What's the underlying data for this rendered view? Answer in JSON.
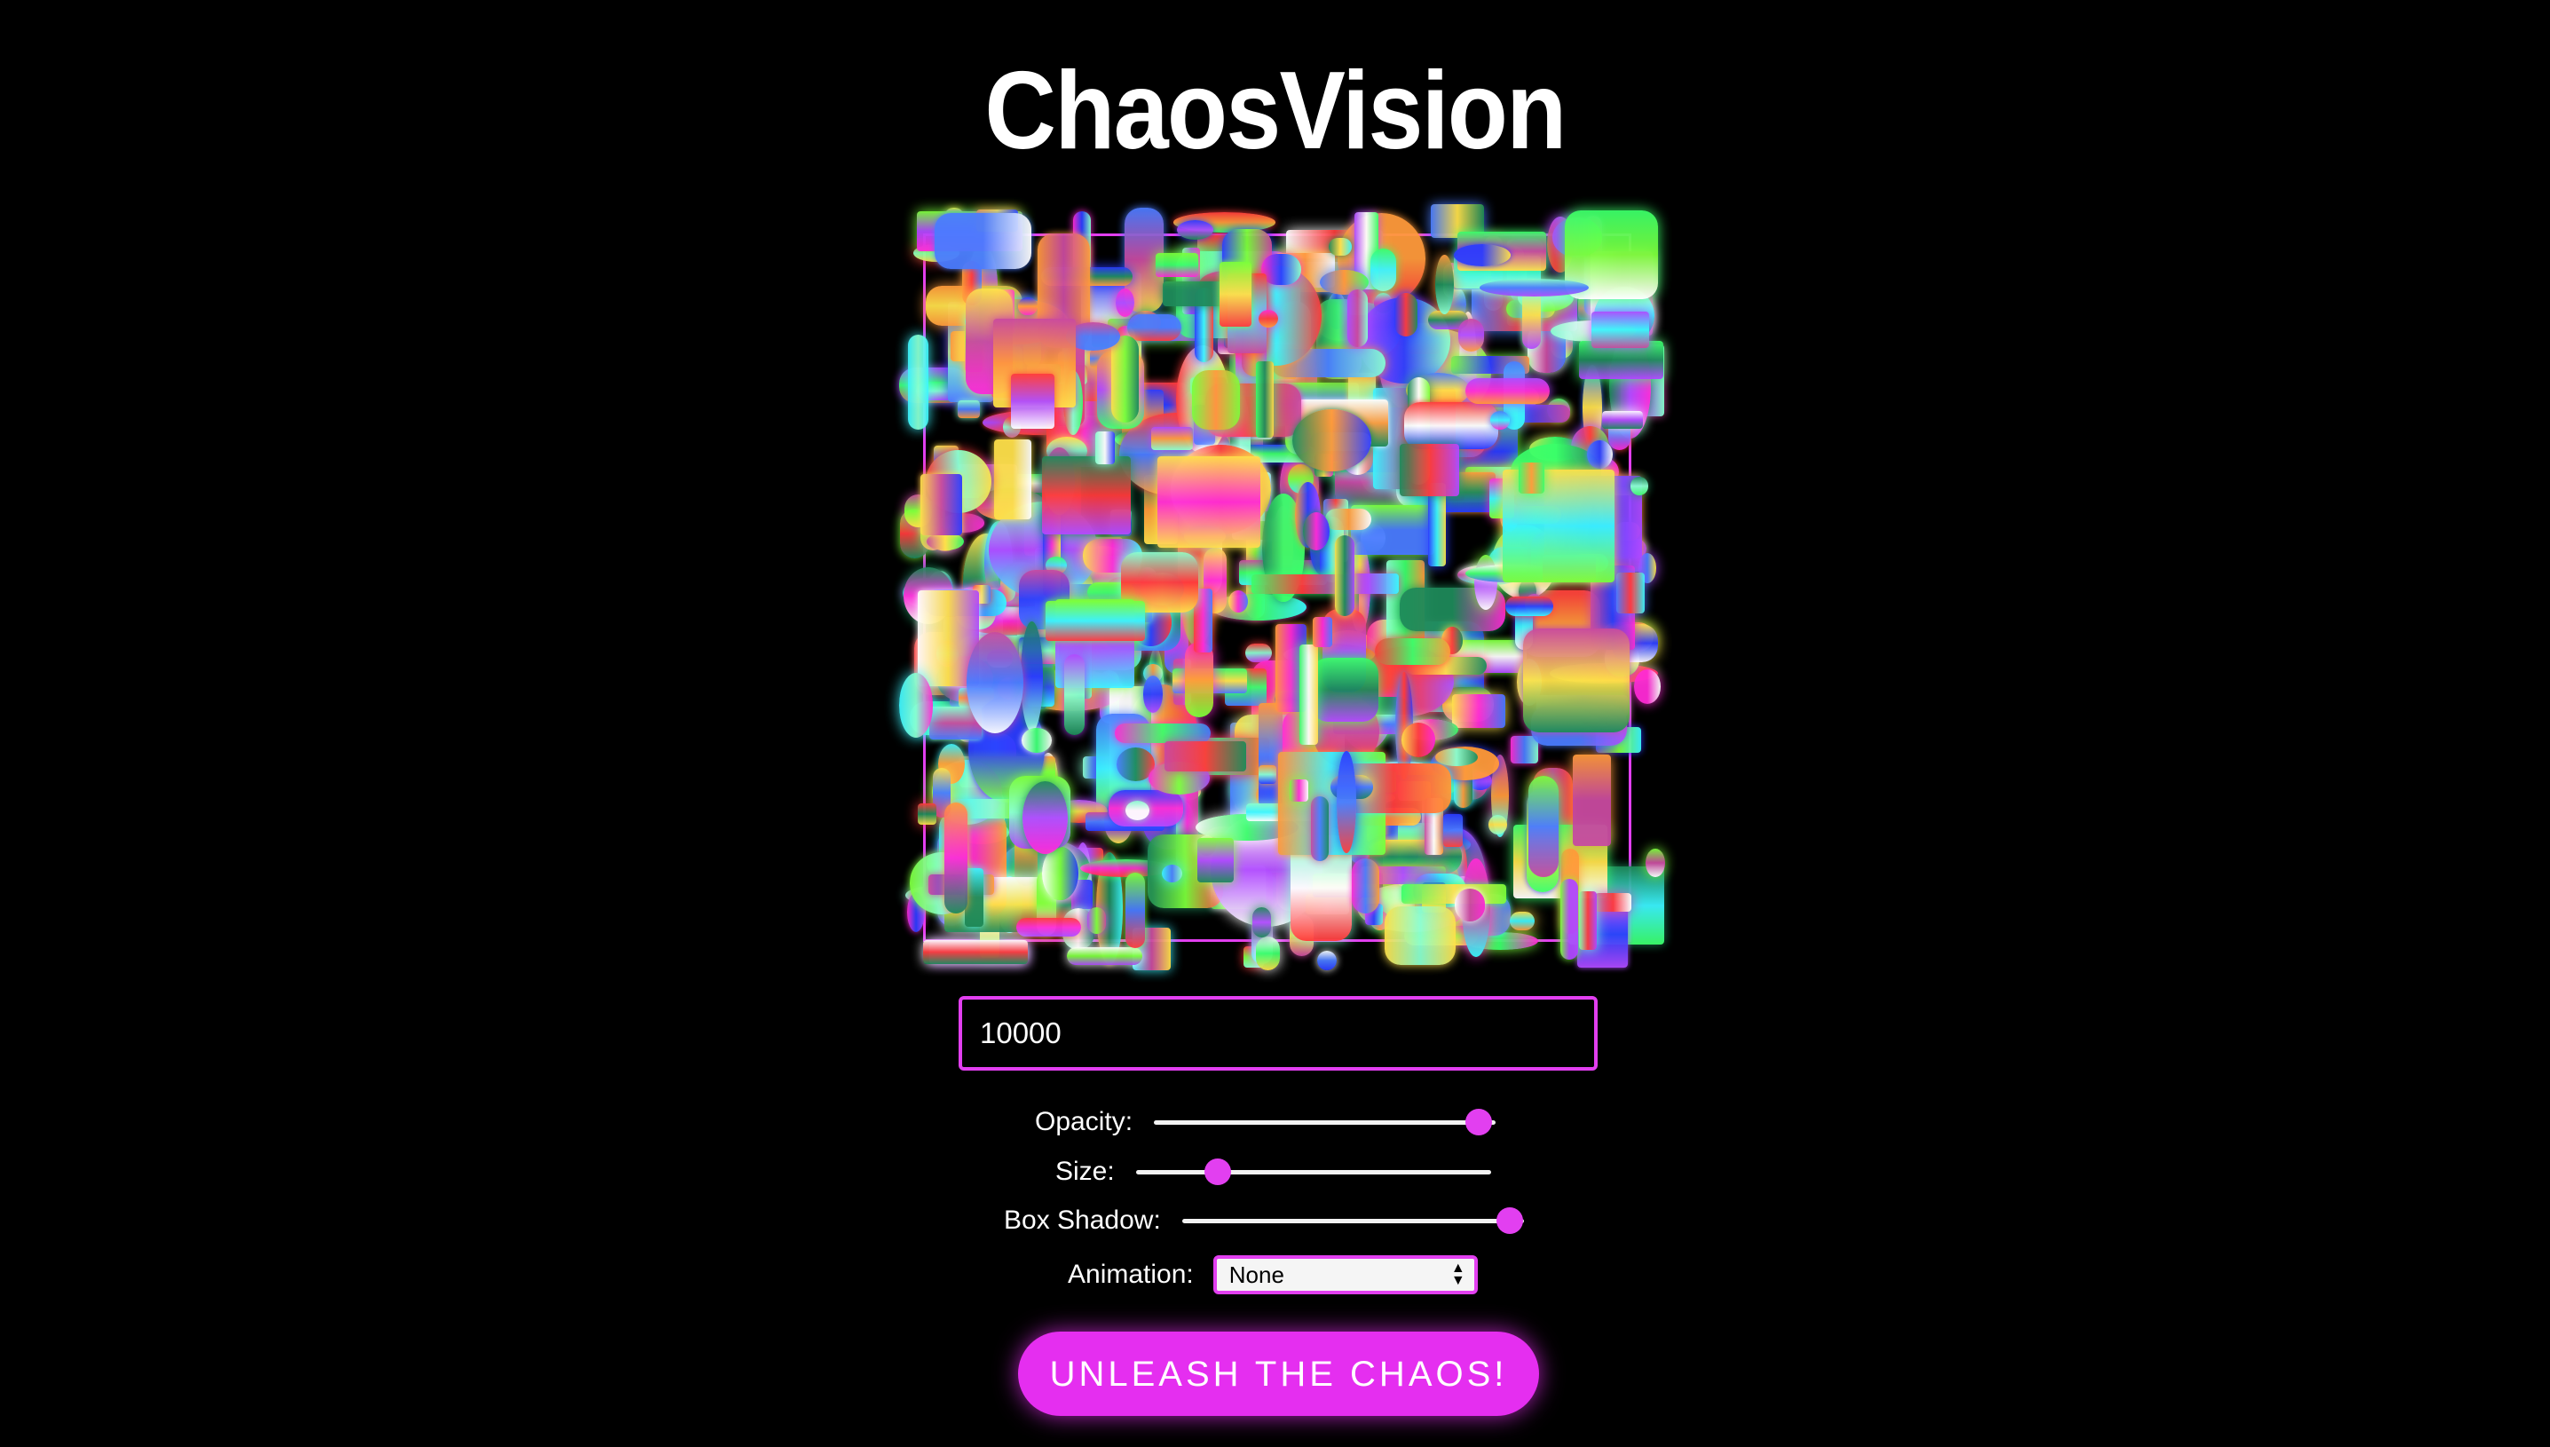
{
  "app": {
    "title": "ChaosVision"
  },
  "canvas": {
    "shape_count": 10000,
    "accent_color": "#e23ff0"
  },
  "controls": {
    "count_input_value": "10000",
    "opacity": {
      "label": "Opacity:",
      "value": 0.95
    },
    "size": {
      "label": "Size:",
      "value": 0.23
    },
    "box_shadow": {
      "label": "Box Shadow:",
      "value": 0.96
    },
    "animation": {
      "label": "Animation:",
      "selected": "None"
    }
  },
  "action": {
    "button_label": "UNLEASH THE CHAOS!"
  },
  "colors": {
    "background": "#000000",
    "accent": "#e23ff0",
    "text": "#ffffff"
  }
}
